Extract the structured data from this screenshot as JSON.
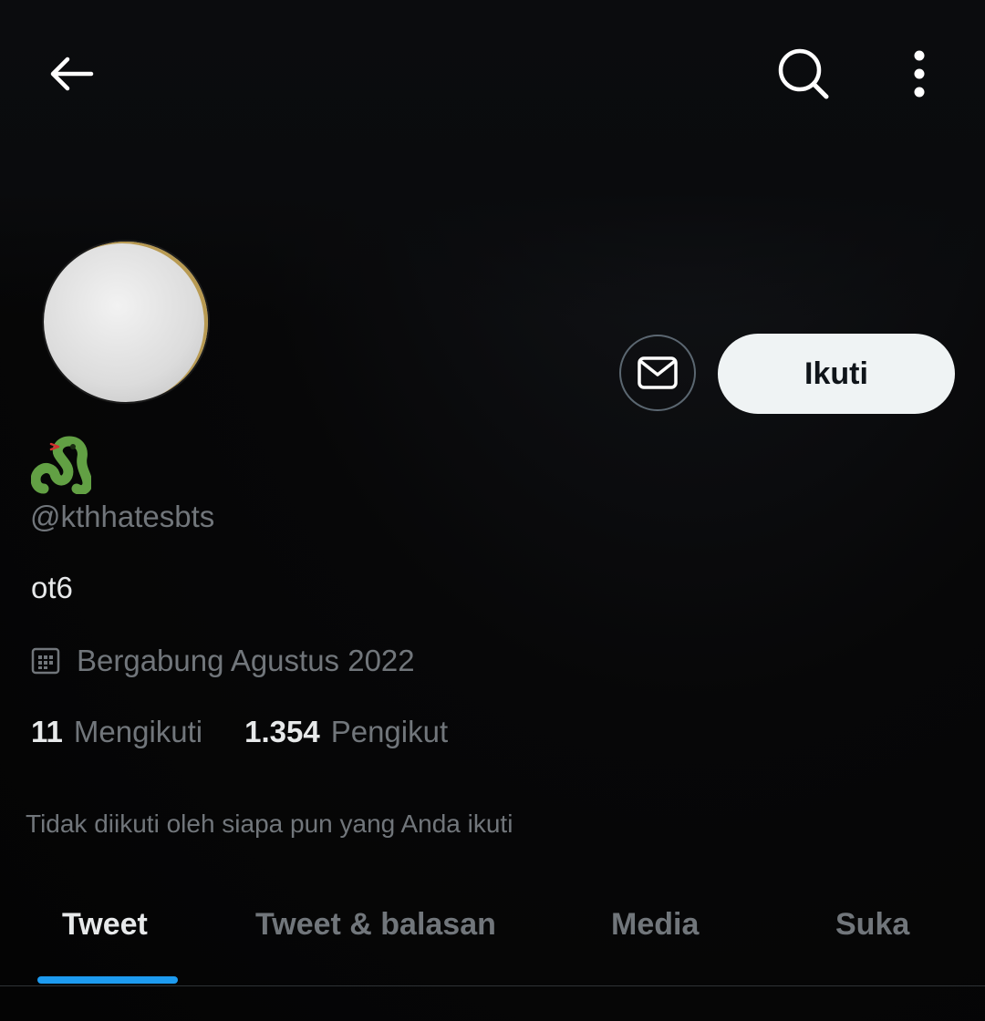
{
  "header": {
    "back_icon": "arrow-left-icon",
    "search_icon": "search-icon",
    "more_icon": "more-vertical-icon"
  },
  "profile": {
    "display_name_icon": "snake-emoji",
    "handle": "@kthhatesbts",
    "bio": "ot6",
    "joined": "Bergabung Agustus 2022",
    "joined_icon": "calendar-icon",
    "following_count": "11",
    "following_label": "Mengikuti",
    "followers_count": "1.354",
    "followers_label": "Pengikut",
    "followed_by_note": "Tidak diikuti oleh siapa pun yang Anda ikuti"
  },
  "actions": {
    "message_icon": "envelope-icon",
    "follow_label": "Ikuti"
  },
  "tabs": [
    {
      "label": "Tweet",
      "active": true
    },
    {
      "label": "Tweet & balasan",
      "active": false
    },
    {
      "label": "Media",
      "active": false
    },
    {
      "label": "Suka",
      "active": false
    }
  ],
  "colors": {
    "accent": "#1d9bf0",
    "background": "#050505",
    "secondary_text": "#71767b",
    "primary_text": "#e7e9ea"
  }
}
